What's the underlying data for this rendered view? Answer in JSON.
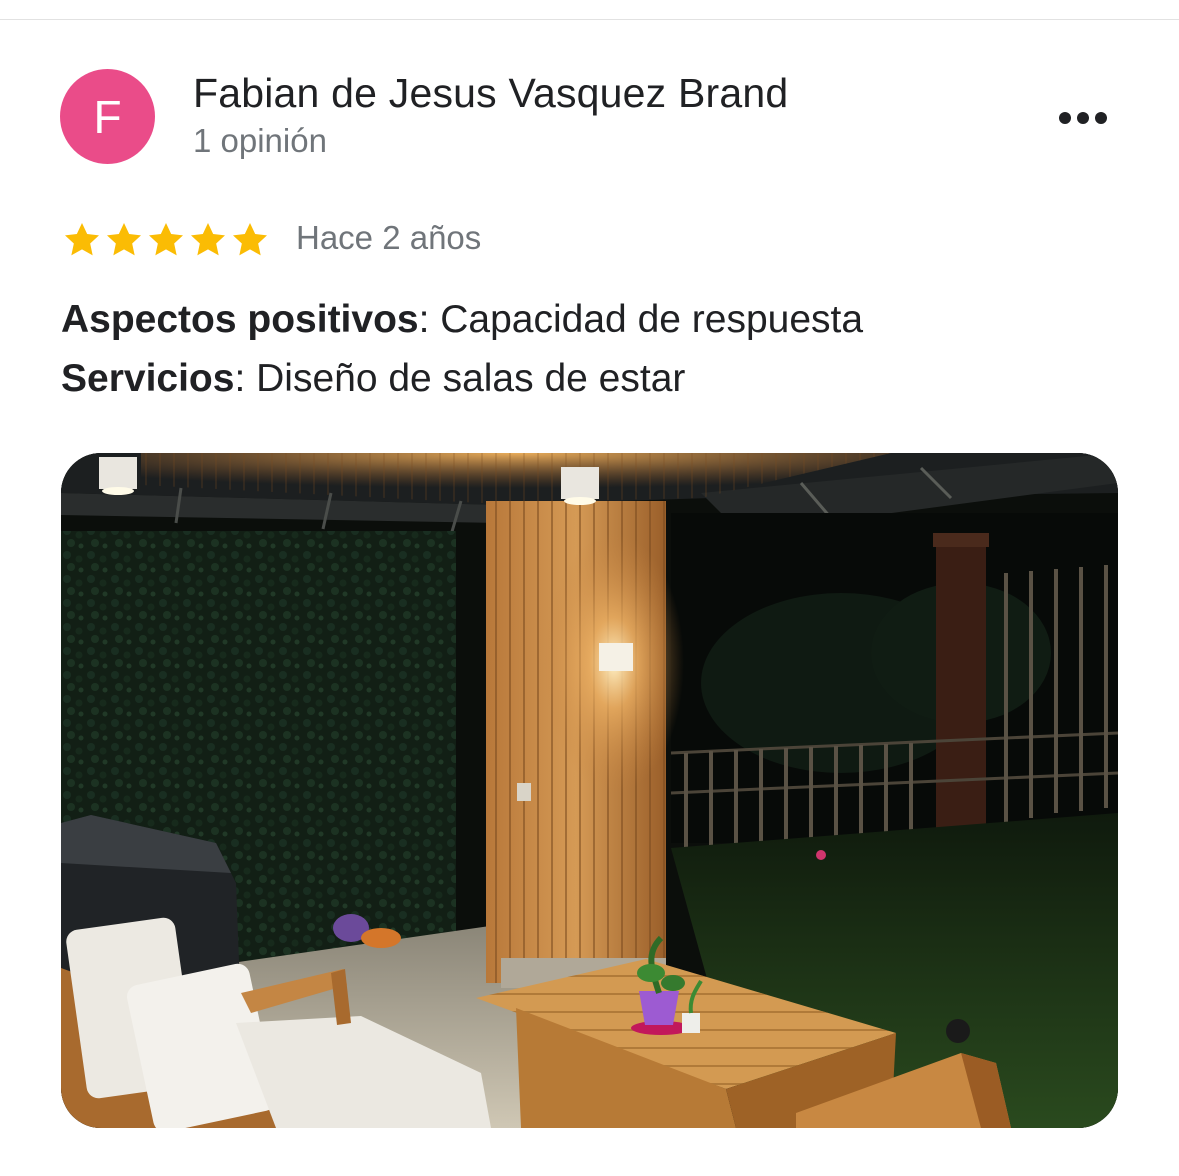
{
  "review": {
    "author": {
      "initial": "F",
      "name": "Fabian de Jesus Vasquez Brand",
      "review_count": "1 opinión",
      "avatar_color": "#ea4c89"
    },
    "menu_icon": "more-horizontal-icon",
    "rating": 5,
    "star_icon": "star-icon",
    "star_color": "#fbbc04",
    "date": "Hace 2 años",
    "attributes": [
      {
        "key": "Aspectos positivos",
        "sep": ": ",
        "value": "Capacidad de respuesta"
      },
      {
        "key": "Servicios",
        "sep": ": ",
        "value": "Diseño de salas de estar"
      }
    ],
    "photo": {
      "icon": "review-photo"
    }
  }
}
